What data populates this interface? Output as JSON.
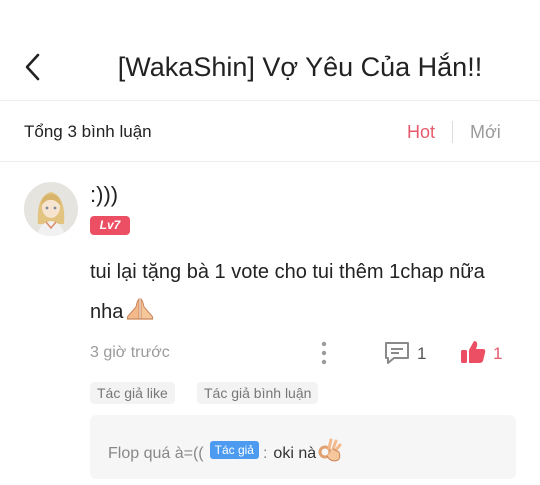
{
  "header": {
    "title": "[WakaShin] Vợ Yêu Của Hắn!!",
    "back_icon": "chevron-left-icon"
  },
  "sort_bar": {
    "total_label": "Tổng 3 bình luận",
    "hot_label": "Hot",
    "new_label": "Mới",
    "active_color": "#e55b6c"
  },
  "comment": {
    "username": ":)))",
    "level": "Lv7",
    "text": "tui lại tặng bà 1 vote cho tui thêm 1chap nữa nha",
    "text_emoji": "folded-hands-emoji",
    "time": "3 giờ trước",
    "reply_count": "1",
    "like_count": "1",
    "tags": [
      "Tác giả like",
      "Tác giả bình luận"
    ],
    "reply": {
      "prefix": "Flop quá à=((",
      "author_badge": "Tác giả",
      "separator": ":",
      "content": "oki nà",
      "emoji": "ok-hand-emoji"
    }
  }
}
